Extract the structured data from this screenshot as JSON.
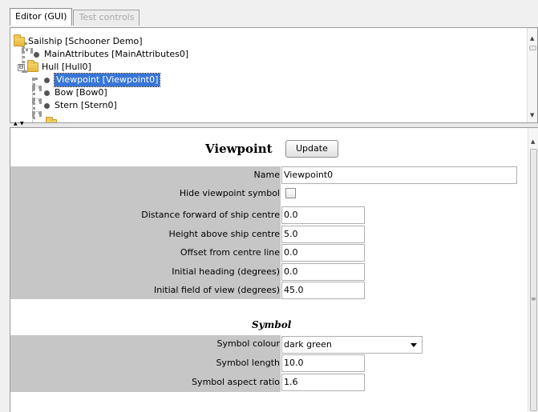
{
  "tabs": [
    {
      "label": "Editor (GUI)",
      "active": true
    },
    {
      "label": "Test controls",
      "active": false
    }
  ],
  "tree": {
    "items": [
      {
        "label": "Sailship [Schooner Demo]",
        "icon": "folder-icon"
      },
      {
        "label": "MainAttributes [MainAttributes0]",
        "icon": "node-bullet-icon"
      },
      {
        "label": "Hull [Hull0]",
        "icon": "folder-icon",
        "expander": "⊟"
      },
      {
        "label": "Viewpoint [Viewpoint0]",
        "icon": "node-bullet-icon",
        "selected": true
      },
      {
        "label": "Bow [Bow0]",
        "icon": "node-bullet-icon"
      },
      {
        "label": "Stern [Stern0]",
        "icon": "node-bullet-icon"
      }
    ]
  },
  "properties": {
    "title": "Viewpoint",
    "update_label": "Update",
    "rows": [
      {
        "label": "Name",
        "value": "Viewpoint0"
      },
      {
        "label": "Hide viewpoint symbol",
        "checked": false
      },
      {
        "label": "Distance forward of ship centre",
        "value": "0.0"
      },
      {
        "label": "Height above ship centre",
        "value": "5.0"
      },
      {
        "label": "Offset from centre line",
        "value": "0.0"
      },
      {
        "label": "Initial heading (degrees)",
        "value": "0.0"
      },
      {
        "label": "Initial field of view (degrees)",
        "value": "45.0"
      }
    ],
    "symbol": {
      "heading": "Symbol",
      "rows": [
        {
          "label": "Symbol colour",
          "value": "dark green"
        },
        {
          "label": "Symbol length",
          "value": "10.0"
        },
        {
          "label": "Symbol aspect ratio",
          "value": "1.6"
        }
      ]
    }
  },
  "colors": {
    "selection": "#3875d7",
    "band": "#c6c6c6"
  }
}
